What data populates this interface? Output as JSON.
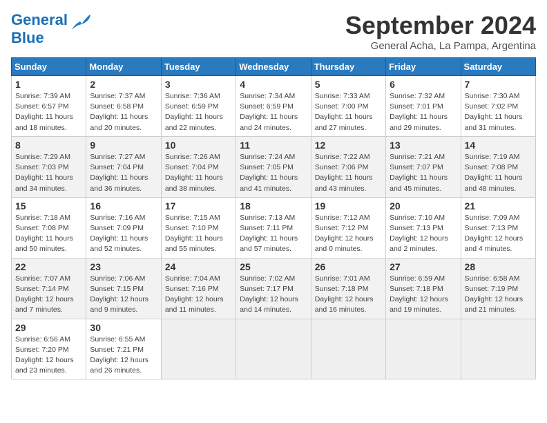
{
  "logo": {
    "line1": "General",
    "line2": "Blue"
  },
  "title": "September 2024",
  "subtitle": "General Acha, La Pampa, Argentina",
  "headers": [
    "Sunday",
    "Monday",
    "Tuesday",
    "Wednesday",
    "Thursday",
    "Friday",
    "Saturday"
  ],
  "weeks": [
    [
      {
        "day": "1",
        "info": "Sunrise: 7:39 AM\nSunset: 6:57 PM\nDaylight: 11 hours\nand 18 minutes."
      },
      {
        "day": "2",
        "info": "Sunrise: 7:37 AM\nSunset: 6:58 PM\nDaylight: 11 hours\nand 20 minutes."
      },
      {
        "day": "3",
        "info": "Sunrise: 7:36 AM\nSunset: 6:59 PM\nDaylight: 11 hours\nand 22 minutes."
      },
      {
        "day": "4",
        "info": "Sunrise: 7:34 AM\nSunset: 6:59 PM\nDaylight: 11 hours\nand 24 minutes."
      },
      {
        "day": "5",
        "info": "Sunrise: 7:33 AM\nSunset: 7:00 PM\nDaylight: 11 hours\nand 27 minutes."
      },
      {
        "day": "6",
        "info": "Sunrise: 7:32 AM\nSunset: 7:01 PM\nDaylight: 11 hours\nand 29 minutes."
      },
      {
        "day": "7",
        "info": "Sunrise: 7:30 AM\nSunset: 7:02 PM\nDaylight: 11 hours\nand 31 minutes."
      }
    ],
    [
      {
        "day": "8",
        "info": "Sunrise: 7:29 AM\nSunset: 7:03 PM\nDaylight: 11 hours\nand 34 minutes."
      },
      {
        "day": "9",
        "info": "Sunrise: 7:27 AM\nSunset: 7:04 PM\nDaylight: 11 hours\nand 36 minutes."
      },
      {
        "day": "10",
        "info": "Sunrise: 7:26 AM\nSunset: 7:04 PM\nDaylight: 11 hours\nand 38 minutes."
      },
      {
        "day": "11",
        "info": "Sunrise: 7:24 AM\nSunset: 7:05 PM\nDaylight: 11 hours\nand 41 minutes."
      },
      {
        "day": "12",
        "info": "Sunrise: 7:22 AM\nSunset: 7:06 PM\nDaylight: 11 hours\nand 43 minutes."
      },
      {
        "day": "13",
        "info": "Sunrise: 7:21 AM\nSunset: 7:07 PM\nDaylight: 11 hours\nand 45 minutes."
      },
      {
        "day": "14",
        "info": "Sunrise: 7:19 AM\nSunset: 7:08 PM\nDaylight: 11 hours\nand 48 minutes."
      }
    ],
    [
      {
        "day": "15",
        "info": "Sunrise: 7:18 AM\nSunset: 7:08 PM\nDaylight: 11 hours\nand 50 minutes."
      },
      {
        "day": "16",
        "info": "Sunrise: 7:16 AM\nSunset: 7:09 PM\nDaylight: 11 hours\nand 52 minutes."
      },
      {
        "day": "17",
        "info": "Sunrise: 7:15 AM\nSunset: 7:10 PM\nDaylight: 11 hours\nand 55 minutes."
      },
      {
        "day": "18",
        "info": "Sunrise: 7:13 AM\nSunset: 7:11 PM\nDaylight: 11 hours\nand 57 minutes."
      },
      {
        "day": "19",
        "info": "Sunrise: 7:12 AM\nSunset: 7:12 PM\nDaylight: 12 hours\nand 0 minutes."
      },
      {
        "day": "20",
        "info": "Sunrise: 7:10 AM\nSunset: 7:13 PM\nDaylight: 12 hours\nand 2 minutes."
      },
      {
        "day": "21",
        "info": "Sunrise: 7:09 AM\nSunset: 7:13 PM\nDaylight: 12 hours\nand 4 minutes."
      }
    ],
    [
      {
        "day": "22",
        "info": "Sunrise: 7:07 AM\nSunset: 7:14 PM\nDaylight: 12 hours\nand 7 minutes."
      },
      {
        "day": "23",
        "info": "Sunrise: 7:06 AM\nSunset: 7:15 PM\nDaylight: 12 hours\nand 9 minutes."
      },
      {
        "day": "24",
        "info": "Sunrise: 7:04 AM\nSunset: 7:16 PM\nDaylight: 12 hours\nand 11 minutes."
      },
      {
        "day": "25",
        "info": "Sunrise: 7:02 AM\nSunset: 7:17 PM\nDaylight: 12 hours\nand 14 minutes."
      },
      {
        "day": "26",
        "info": "Sunrise: 7:01 AM\nSunset: 7:18 PM\nDaylight: 12 hours\nand 16 minutes."
      },
      {
        "day": "27",
        "info": "Sunrise: 6:59 AM\nSunset: 7:18 PM\nDaylight: 12 hours\nand 19 minutes."
      },
      {
        "day": "28",
        "info": "Sunrise: 6:58 AM\nSunset: 7:19 PM\nDaylight: 12 hours\nand 21 minutes."
      }
    ],
    [
      {
        "day": "29",
        "info": "Sunrise: 6:56 AM\nSunset: 7:20 PM\nDaylight: 12 hours\nand 23 minutes."
      },
      {
        "day": "30",
        "info": "Sunrise: 6:55 AM\nSunset: 7:21 PM\nDaylight: 12 hours\nand 26 minutes."
      },
      {
        "day": "",
        "info": ""
      },
      {
        "day": "",
        "info": ""
      },
      {
        "day": "",
        "info": ""
      },
      {
        "day": "",
        "info": ""
      },
      {
        "day": "",
        "info": ""
      }
    ]
  ]
}
